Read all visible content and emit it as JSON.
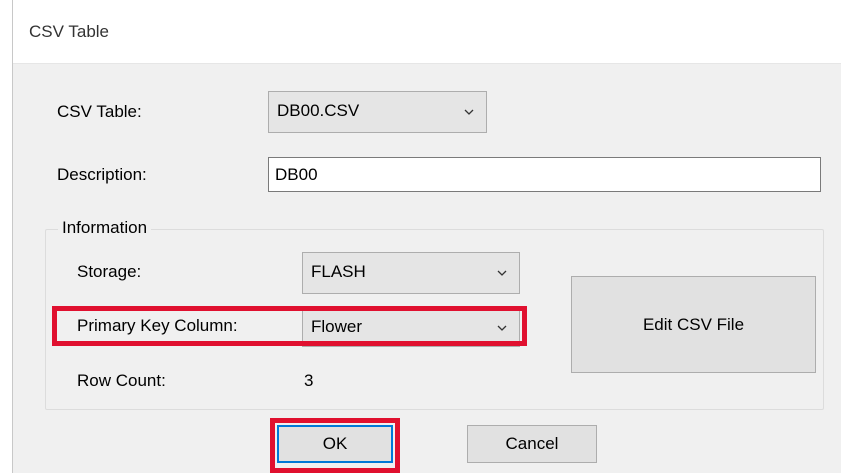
{
  "window": {
    "title": "CSV Table"
  },
  "form": {
    "csv_table_label": "CSV Table:",
    "csv_table_value": "DB00.CSV",
    "description_label": "Description:",
    "description_value": "DB00"
  },
  "information": {
    "group_label": "Information",
    "storage_label": "Storage:",
    "storage_value": "FLASH",
    "primary_key_label": "Primary Key Column:",
    "primary_key_value": "Flower",
    "row_count_label": "Row Count:",
    "row_count_value": "3",
    "edit_button_label": "Edit CSV File"
  },
  "buttons": {
    "ok_label": "OK",
    "cancel_label": "Cancel"
  },
  "highlights": {
    "color": "#e0102f",
    "targets": [
      "primary-key-row",
      "ok-button"
    ]
  },
  "icons": {
    "dropdown": "chevron-down-icon"
  }
}
